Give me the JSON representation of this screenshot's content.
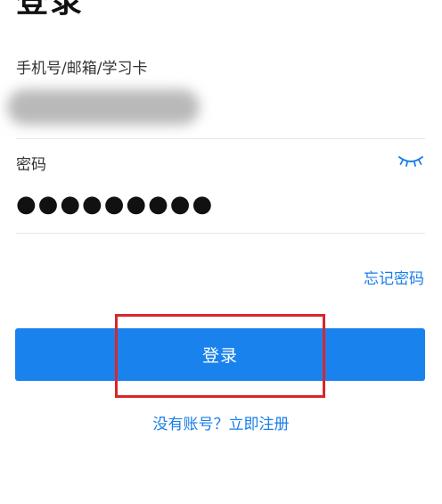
{
  "page": {
    "title": "登录"
  },
  "account": {
    "label": "手机号/邮箱/学习卡",
    "value": ""
  },
  "password": {
    "label": "密码",
    "masked_value": "●●●●●●●●●",
    "toggle_icon": "eye-closed-icon"
  },
  "links": {
    "forgot_password": "忘记密码",
    "register": "没有账号？立即注册"
  },
  "login_button": {
    "label": "登录"
  },
  "colors": {
    "accent": "#1a82ed",
    "link": "#1a7ee8",
    "highlight": "#d9262a"
  }
}
